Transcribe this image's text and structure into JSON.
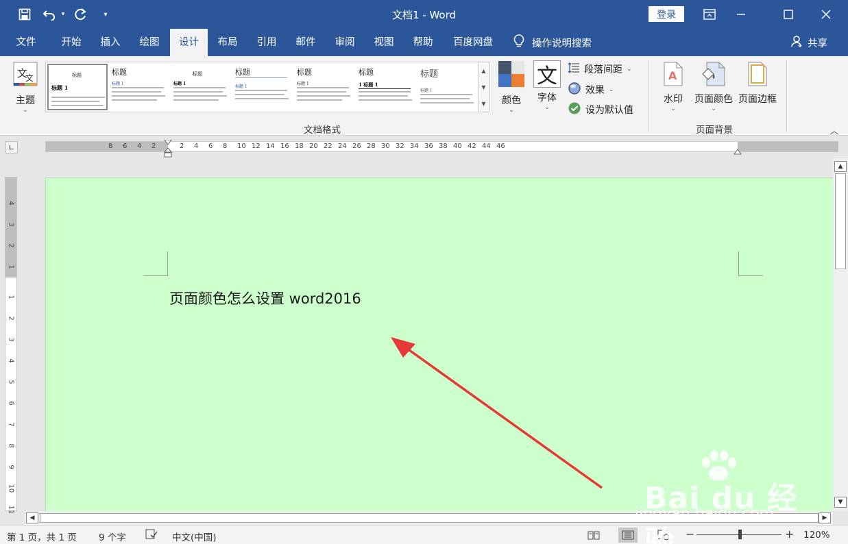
{
  "colors": {
    "ribbon_blue": "#2b579a",
    "page_color": "#ccffcc",
    "arrow": "#e53935"
  },
  "titlebar": {
    "title": "文档1  -  Word",
    "login": "登录",
    "icons": [
      "save-icon",
      "undo-icon",
      "redo-icon",
      "customize-qat-icon",
      "ribbon-display-icon",
      "minimize-icon",
      "maximize-icon",
      "close-icon"
    ]
  },
  "tabs": [
    {
      "label": "文件"
    },
    {
      "label": "开始"
    },
    {
      "label": "插入"
    },
    {
      "label": "绘图"
    },
    {
      "label": "设计",
      "active": true
    },
    {
      "label": "布局"
    },
    {
      "label": "引用"
    },
    {
      "label": "邮件"
    },
    {
      "label": "审阅"
    },
    {
      "label": "视图"
    },
    {
      "label": "帮助"
    },
    {
      "label": "百度网盘"
    }
  ],
  "tell_me": "操作说明搜索",
  "share": "共享",
  "ribbon": {
    "theme_label": "主题",
    "gallery_items": [
      {
        "title": "标题",
        "heading": "标题 1"
      },
      {
        "title": "标题",
        "heading": "标题 1"
      },
      {
        "title": "标题",
        "heading": "标题 1"
      },
      {
        "title": "标题",
        "heading": "标题 1"
      },
      {
        "title": "标题",
        "heading": "标题 1"
      },
      {
        "title": "标题",
        "heading": "1  标题 1"
      },
      {
        "title": "标题",
        "heading": "标题 1"
      }
    ],
    "colors_label": "颜色",
    "fonts_label": "字体",
    "font_glyph": "文",
    "paragraph_spacing": "段落间距",
    "effects": "效果",
    "set_default": "设为默认值",
    "group_document_format": "文档格式",
    "watermark": "水印",
    "page_color": "页面颜色",
    "page_borders": "页面边框",
    "group_page_background": "页面背景"
  },
  "ruler": {
    "h_labels": [
      "8",
      "6",
      "4",
      "2",
      "2",
      "4",
      "6",
      "8",
      "10",
      "12",
      "14",
      "16",
      "18",
      "20",
      "22",
      "24",
      "26",
      "28",
      "30",
      "32",
      "34",
      "36",
      "38",
      "40",
      "42",
      "44",
      "46"
    ],
    "v_labels": [
      "4",
      "3",
      "2",
      "1",
      "1",
      "2",
      "3",
      "4",
      "5",
      "6",
      "7",
      "8",
      "9",
      "10",
      "11"
    ]
  },
  "document": {
    "text": "页面颜色怎么设置 word2016"
  },
  "statusbar": {
    "page": "第 1 页，共 1 页",
    "words": "9 个字",
    "language": "中文(中国)",
    "zoom": "120%",
    "zoom_minus": "−",
    "zoom_plus": "+"
  },
  "watermark": {
    "brand": "Bai du 经验",
    "url": "jingyan.baidu.com"
  }
}
